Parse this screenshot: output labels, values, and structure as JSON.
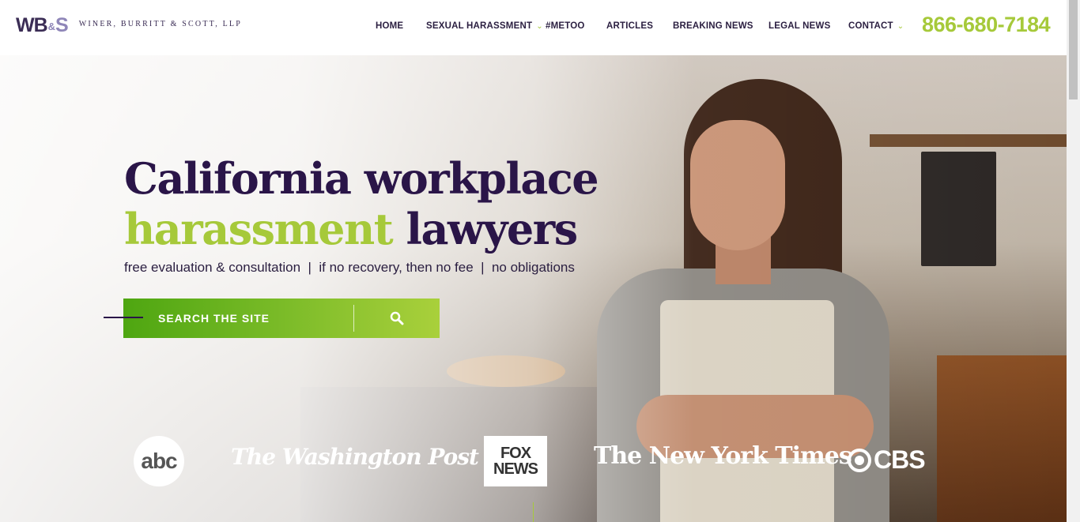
{
  "header": {
    "logo_mark": "WB",
    "logo_amp": "&",
    "logo_s": "S",
    "firm_name": "WINER, BURRITT & SCOTT, LLP",
    "phone": "866-680-7184"
  },
  "nav": {
    "items": [
      {
        "label": "HOME",
        "has_dropdown": false
      },
      {
        "label": "SEXUAL HARASSMENT",
        "has_dropdown": true
      },
      {
        "label": "#METOO",
        "has_dropdown": false
      },
      {
        "label": "ARTICLES",
        "has_dropdown": false
      },
      {
        "label": "BREAKING NEWS",
        "has_dropdown": false
      },
      {
        "label": "LEGAL NEWS",
        "has_dropdown": false
      },
      {
        "label": "CONTACT",
        "has_dropdown": true
      }
    ],
    "dropdown_icon": "chevron-down-icon"
  },
  "hero": {
    "headline_line1": "California workplace",
    "headline_accent": "harassment",
    "headline_rest": "lawyers",
    "tagline": "free evaluation & consultation  |  if no recovery, then no fee  |  no obligations"
  },
  "search": {
    "placeholder": "SEARCH THE SITE",
    "icon": "search-icon"
  },
  "media": {
    "abc": "abc",
    "washington_post": "The Washington Post",
    "fox_line1": "FOX",
    "fox_line2": "NEWS",
    "nyt": "The New York Times",
    "cbs": "CBS"
  },
  "colors": {
    "brand_dark": "#2a1548",
    "brand_green": "#a6c93a",
    "logo_purple": "#8f86b8"
  }
}
